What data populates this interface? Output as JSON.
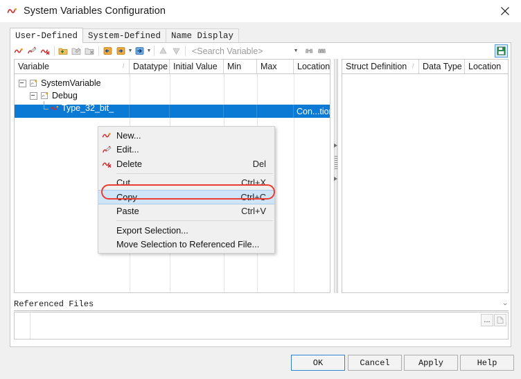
{
  "window": {
    "title": "System Variables Configuration",
    "icon": "wave-variable-icon",
    "close_label": "×"
  },
  "tabs": [
    {
      "label": "User-Defined",
      "active": true
    },
    {
      "label": "System-Defined",
      "active": false
    },
    {
      "label": "Name Display",
      "active": false
    }
  ],
  "toolbar": {
    "search_placeholder": "<Search Variable>",
    "dropdown_caret": "▾",
    "buttons": [
      "new-variable-icon",
      "edit-variable-icon",
      "delete-variable-icon",
      "new-group-icon",
      "edit-group-icon",
      "delete-group-icon",
      "import-icon",
      "export-icon",
      "export-options-icon",
      "move-up-icon",
      "move-down-icon"
    ],
    "find_icon": "binoculars-icon",
    "find_all_icon": "binoculars-all-icon",
    "toggle_icon": "show-struct-panel-icon"
  },
  "left_grid": {
    "columns": [
      "Variable",
      "Datatype",
      "Initial Value",
      "Min",
      "Max",
      "Location"
    ],
    "sort_column": "Variable",
    "rows": [
      {
        "indent": 0,
        "icon": "folder-variable-icon",
        "label": "SystemVariable",
        "expander": "minus"
      },
      {
        "indent": 1,
        "icon": "folder-variable-icon",
        "label": "Debug",
        "expander": "minus"
      },
      {
        "indent": 2,
        "icon": "wave-variable-icon",
        "label": "Type_32_bit_",
        "selected": true,
        "location": "Con...tion"
      }
    ]
  },
  "right_grid": {
    "columns": [
      "Struct Definition",
      "Data Type",
      "Location"
    ],
    "sort_column": "Struct Definition",
    "rows": []
  },
  "referenced_files": {
    "title": "Referenced Files",
    "collapse_icon": "chevron-down-icon",
    "browse_label": "...",
    "open_icon": "document-icon",
    "value": ""
  },
  "context_menu": {
    "items": [
      {
        "label": "New...",
        "accel": "",
        "icon": "new-variable-icon",
        "highlighted": false,
        "separator_after": false
      },
      {
        "label": "Edit...",
        "accel": "",
        "icon": "edit-variable-icon",
        "highlighted": false,
        "separator_after": false
      },
      {
        "label": "Delete",
        "accel": "Del",
        "icon": "delete-variable-icon",
        "highlighted": false,
        "separator_after": true
      },
      {
        "label": "Cut",
        "accel": "Ctrl+X",
        "icon": "",
        "highlighted": false,
        "separator_after": false
      },
      {
        "label": "Copy",
        "accel": "Ctrl+C",
        "icon": "",
        "highlighted": true,
        "separator_after": false
      },
      {
        "label": "Paste",
        "accel": "Ctrl+V",
        "icon": "",
        "highlighted": false,
        "separator_after": true
      },
      {
        "label": "Export Selection...",
        "accel": "",
        "icon": "",
        "highlighted": false,
        "separator_after": false
      },
      {
        "label": "Move Selection to Referenced File...",
        "accel": "",
        "icon": "",
        "highlighted": false,
        "separator_after": false
      }
    ]
  },
  "footer": {
    "ok": "OK",
    "cancel": "Cancel",
    "apply": "Apply",
    "help": "Help"
  },
  "colors": {
    "selection_blue": "#0a7ad4",
    "menu_hover": "#cfe4f7",
    "annotation_red": "#ee3b2f",
    "focus_blue": "#2a7fd4",
    "toolbar_toggle_blue": "#5b9bd5"
  }
}
